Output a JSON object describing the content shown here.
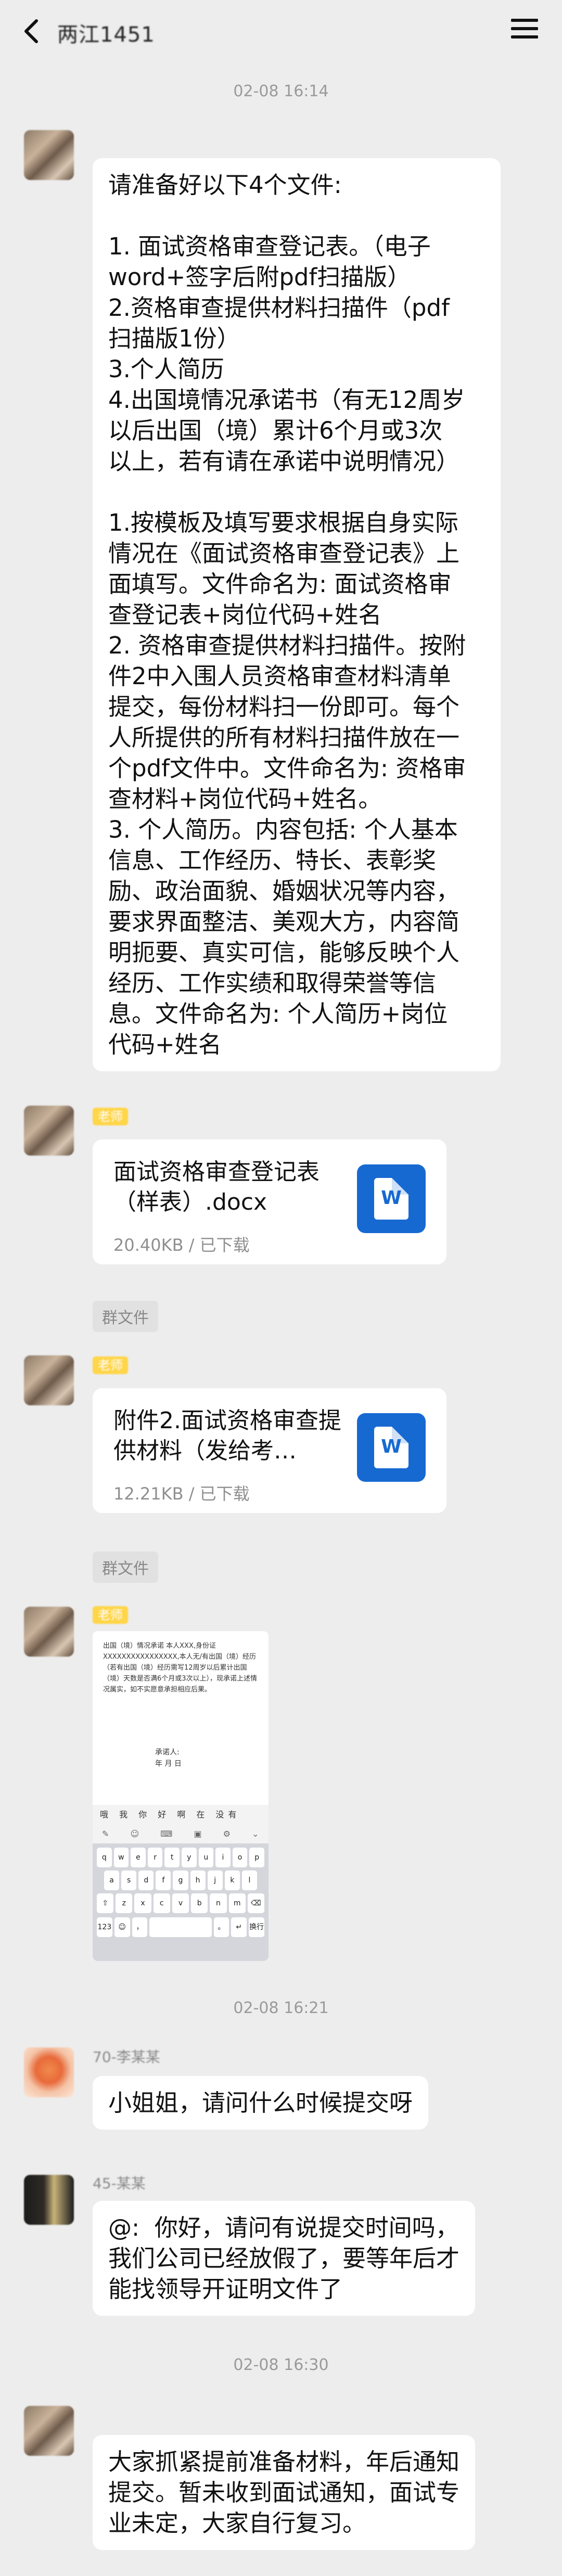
{
  "header": {
    "title": "两江1451",
    "back_icon": "chevron-left-icon",
    "menu_icon": "hamburger-menu-icon"
  },
  "timestamps": [
    "02-08 16:14",
    "02-08 16:21",
    "02-08 16:30"
  ],
  "messages": {
    "m1": {
      "lines": [
        "请准备好以下4个文件:",
        "",
        "1. 面试资格审查登记表。（电子",
        "word+签字后附pdf扫描版）",
        "2.资格审查提供材料扫描件（pdf",
        "扫描版1份）",
        "3.个人简历",
        "4.出国境情况承诺书（有无12周岁",
        "以后出国（境）累计6个月或3次",
        "以上，若有请在承诺中说明情况）",
        "",
        "1.按模板及填写要求根据自身实际",
        "情况在《面试资格审查登记表》上",
        "面填写。文件命名为: 面试资格审",
        "查登记表+岗位代码+姓名",
        "2. 资格审查提供材料扫描件。按附",
        "件2中入围人员资格审查材料清单",
        "提交，每份材料扫一份即可。每个",
        "人所提供的所有材料扫描件放在一",
        "个pdf文件中。文件命名为: 资格审",
        "查材料+岗位代码+姓名。",
        "3. 个人简历。内容包括: 个人基本",
        "信息、工作经历、特长、表彰奖",
        "励、政治面貌、婚姻状况等内容，",
        "要求界面整洁、美观大方，内容简",
        "明扼要、真实可信，能够反映个人",
        "经历、工作实绩和取得荣誉等信",
        "息。文件命名为: 个人简历+岗位",
        "代码+姓名"
      ]
    },
    "file1": {
      "tag": "老师",
      "name": "面试资格审查登记表（样表）.docx",
      "meta": "20.40KB / 已下载",
      "source": "群文件"
    },
    "file2": {
      "tag": "老师",
      "name": "附件2.面试资格审查提供材料（发给考…",
      "meta": "12.21KB / 已下载",
      "source": "群文件"
    },
    "image": {
      "tag": "老师",
      "doc_text": "出国（境）情况承诺 本人XXX,身份证XXXXXXXXXXXXXXXX,本人无/有出国（境）经历（若有出国（境）经历需写12周岁以后累计出国（境）天数是否满6个月或3次以上），现承诺上述情况属实，如不实愿意承担相应后果。",
      "sign": "承诺人:\n年 月 日",
      "kb_candidates": "哦 我 你 好 啊 在 没有",
      "kb_rows": [
        [
          "q",
          "w",
          "e",
          "r",
          "t",
          "y",
          "u",
          "i",
          "o",
          "p"
        ],
        [
          "a",
          "s",
          "d",
          "f",
          "g",
          "h",
          "j",
          "k",
          "l"
        ],
        [
          "⇧",
          "z",
          "x",
          "c",
          "v",
          "b",
          "n",
          "m",
          "⌫"
        ],
        [
          "123",
          "☺",
          "，",
          "space",
          "。",
          "↵",
          "换行"
        ]
      ]
    },
    "m2": {
      "sender": "70-李某某",
      "text": "小姐姐，请问什么时候提交呀"
    },
    "m3": {
      "sender": "45-某某",
      "lines": [
        "@:  你好，请问有说提交时间吗，",
        "我们公司已经放假了，要等年后才",
        "能找领导开证明文件了"
      ]
    },
    "m4": {
      "lines": [
        "大家抓紧提前准备材料，年后通知",
        "提交。暂未收到面试通知，面试专",
        "业未定，大家自行复习。"
      ]
    }
  }
}
